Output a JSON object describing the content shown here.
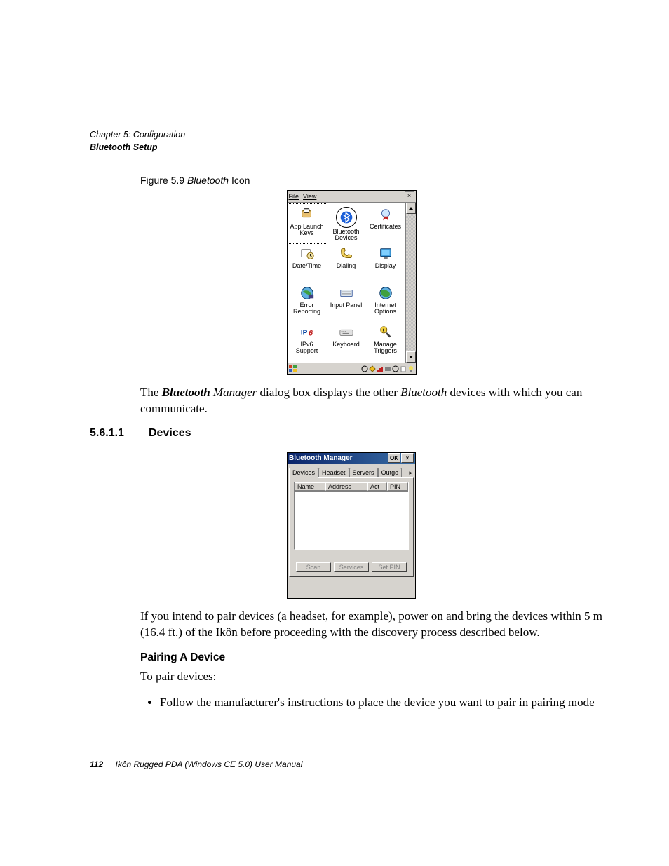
{
  "header": {
    "chapter": "Chapter 5:  Configuration",
    "section": "Bluetooth Setup"
  },
  "figure": {
    "label": "Figure 5.9 ",
    "title_em": "Bluetooth",
    "title_rest": " Icon"
  },
  "cp": {
    "menu": {
      "file": "File",
      "view": "View"
    },
    "items": [
      {
        "label": "App Launch\nKeys"
      },
      {
        "label": "Bluetooth\nDevices"
      },
      {
        "label": "Certificates"
      },
      {
        "label": "Date/Time"
      },
      {
        "label": "Dialing"
      },
      {
        "label": "Display"
      },
      {
        "label": "Error\nReporting"
      },
      {
        "label": "Input Panel"
      },
      {
        "label": "Internet\nOptions"
      },
      {
        "label": "IPv6\nSupport"
      },
      {
        "label": "Keyboard"
      },
      {
        "label": "Manage\nTriggers"
      }
    ]
  },
  "para1_a": "The ",
  "para1_b": "Bluetooth",
  "para1_c": " Manager",
  "para1_d": " dialog box displays the other ",
  "para1_e": "Bluetooth",
  "para1_f": " devices with which you can communicate.",
  "heading2": {
    "num": "5.6.1.1",
    "title": "Devices"
  },
  "bm": {
    "title": "Bluetooth Manager",
    "ok": "OK",
    "tabs": [
      "Devices",
      "Headset",
      "Servers",
      "Outgo"
    ],
    "cols": {
      "name": "Name",
      "addr": "Address",
      "act": "Act",
      "pin": "PIN"
    },
    "buttons": {
      "scan": "Scan",
      "services": "Services",
      "setpin": "Set PIN"
    }
  },
  "para2": "If you intend to pair devices (a headset, for example), power on and bring the devices within 5 m (16.4 ft.) of the Ikôn before proceeding with the discovery process described below.",
  "h5": "Pairing A Device",
  "para3": "To pair devices:",
  "bullet1": "Follow the manufacturer's instructions to place the device you want to pair in pairing mode",
  "footer": {
    "page": "112",
    "title": "Ikôn Rugged PDA (Windows CE 5.0) User Manual"
  }
}
